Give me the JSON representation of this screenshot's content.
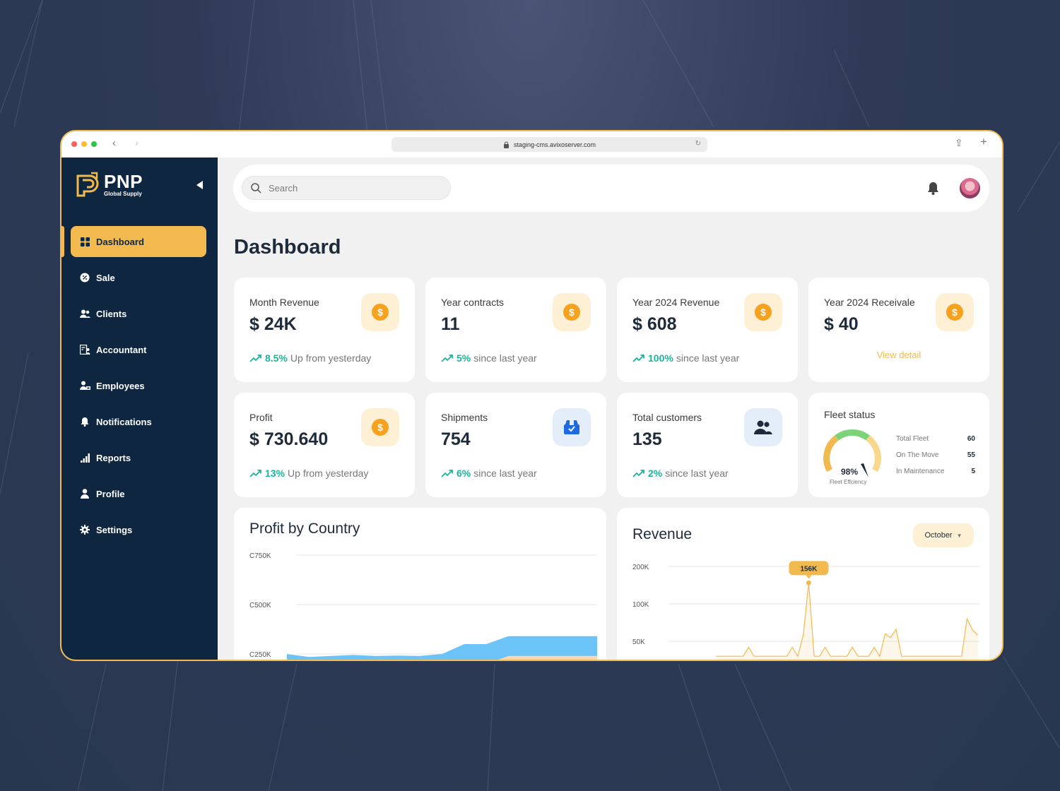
{
  "browser": {
    "url": "staging-cms.avixoserver.com"
  },
  "brand": {
    "name": "PNP",
    "tagline": "Global Supply",
    "accent": "#f2b94f",
    "sidebar_bg": "#0f2640"
  },
  "sidebar": {
    "items": [
      {
        "label": "Dashboard",
        "icon": "grid-icon",
        "active": true
      },
      {
        "label": "Sale",
        "icon": "badge-percent-icon"
      },
      {
        "label": "Clients",
        "icon": "users-icon"
      },
      {
        "label": "Accountant",
        "icon": "accountant-icon"
      },
      {
        "label": "Employees",
        "icon": "employees-icon"
      },
      {
        "label": "Notifications",
        "icon": "bell-icon"
      },
      {
        "label": "Reports",
        "icon": "bar-chart-icon"
      },
      {
        "label": "Profile",
        "icon": "user-icon"
      },
      {
        "label": "Settings",
        "icon": "gear-icon"
      }
    ]
  },
  "header": {
    "search_placeholder": "Search"
  },
  "page": {
    "title": "Dashboard"
  },
  "stats": {
    "month_revenue": {
      "label": "Month Revenue",
      "value": "$ 24K",
      "pct": "8.5%",
      "note": "Up from yesterday"
    },
    "year_contracts": {
      "label": "Year contracts",
      "value": "11",
      "pct": "5%",
      "note": "since last year"
    },
    "year_revenue": {
      "label": "Year 2024 Revenue",
      "value": "$ 608",
      "pct": "100%",
      "note": "since last year"
    },
    "year_receivable": {
      "label": "Year 2024 Receivale",
      "value": "$ 40",
      "link": "View detail"
    },
    "profit": {
      "label": "Profit",
      "value": "$ 730.640",
      "pct": "13%",
      "note": "Up from yesterday"
    },
    "shipments": {
      "label": "Shipments",
      "value": "754",
      "pct": "6%",
      "note": "since last year"
    },
    "customers": {
      "label": "Total customers",
      "value": "135",
      "pct": "2%",
      "note": "since last year"
    }
  },
  "fleet": {
    "title": "Fleet status",
    "efficiency": "98%",
    "efficiency_value": 0.98,
    "efficiency_label": "Fleet Effciency",
    "rows": [
      {
        "label": "Total Fleet",
        "value": "60"
      },
      {
        "label": "On The Move",
        "value": "55"
      },
      {
        "label": "In Maintenance",
        "value": "5"
      }
    ]
  },
  "profit_chart": {
    "title": "Profit by Country"
  },
  "revenue_chart": {
    "title": "Revenue",
    "month": "October"
  },
  "chart_data": [
    {
      "type": "area",
      "title": "Profit by Country",
      "y_ticks": [
        "C750K",
        "C500K",
        "C250K"
      ],
      "ylim": [
        250000,
        750000
      ],
      "series": [
        {
          "color": "#6cc3f7",
          "values": [
            250000,
            235000,
            240000,
            245000,
            240000,
            242000,
            240000,
            250000,
            300000,
            300000,
            340000,
            340000,
            340000,
            340000,
            340000
          ]
        },
        {
          "color": "#fcd7b0",
          "values": [
            200000,
            200000,
            200000,
            200000,
            200000,
            200000,
            200000,
            200000,
            200000,
            200000,
            240000,
            240000,
            240000,
            240000,
            240000
          ]
        }
      ]
    },
    {
      "type": "area",
      "title": "Revenue",
      "y_ticks": [
        "200K",
        "100K",
        "50K"
      ],
      "highlight": {
        "label": "156K",
        "index": 17
      },
      "values": [
        30,
        30,
        30,
        30,
        30,
        30,
        42,
        30,
        30,
        30,
        30,
        30,
        30,
        30,
        42,
        30,
        58,
        156,
        30,
        30,
        42,
        30,
        30,
        30,
        30,
        42,
        30,
        30,
        30,
        42,
        30,
        60,
        55,
        66,
        30,
        30,
        30,
        30,
        30,
        30,
        30,
        30,
        30,
        30,
        30,
        30,
        80,
        65,
        58
      ],
      "color": "#f2b94f"
    }
  ]
}
